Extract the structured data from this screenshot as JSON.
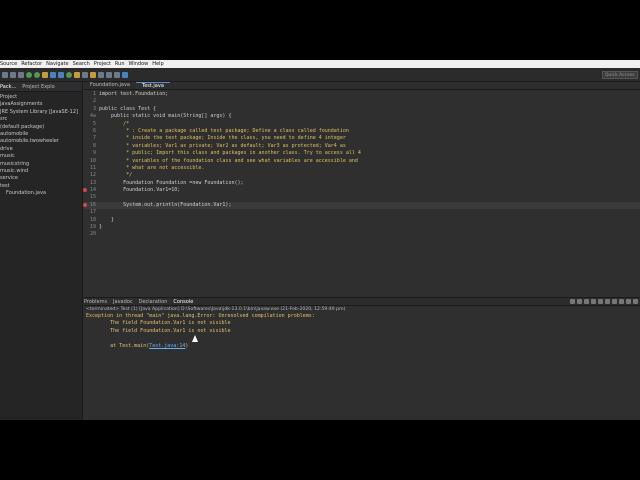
{
  "menu": [
    "Source",
    "Refactor",
    "Navigate",
    "Search",
    "Project",
    "Run",
    "Window",
    "Help"
  ],
  "quick_access_label": "Quick Access",
  "left_panel": {
    "tabs": [
      "Pack...",
      "Project Explo"
    ],
    "tree": [
      "Project",
      "javaAssignments",
      "JRE System Library [JavaSE-12]",
      "src",
      "(default package)",
      "automobile",
      "automobile.twowheeler",
      "drive",
      "music",
      "musicstring",
      "music.wind",
      "service",
      "test",
      "Foundation.java"
    ]
  },
  "editor": {
    "tabs": [
      "Foundation.java",
      "Test.java"
    ],
    "lines": [
      {
        "n": "1",
        "t": "import test.Foundation;"
      },
      {
        "n": "2",
        "t": ""
      },
      {
        "n": "3",
        "t": "public class Test {"
      },
      {
        "n": "4⊖",
        "t": "    public static void main(String[] args) {"
      },
      {
        "n": "5",
        "t": "        /*"
      },
      {
        "n": "6",
        "t": "         * : Create a package called test package; Define a class called foundation"
      },
      {
        "n": "7",
        "t": "         * inside the test package; Inside the class, you need to define 4 integer"
      },
      {
        "n": "8",
        "t": "         * variables; Var1 as private; Var2 as default; Var3 as protected; Var4 as"
      },
      {
        "n": "9",
        "t": "         * public; Import this class and packages in another class. Try to access all 4"
      },
      {
        "n": "10",
        "t": "         * variables of the foundation class and see what variables are accessible and"
      },
      {
        "n": "11",
        "t": "         * what are not accessible."
      },
      {
        "n": "12",
        "t": "         */"
      },
      {
        "n": "13",
        "t": "        Foundation Foundation =new Foundation();"
      },
      {
        "n": "14",
        "t": "        Foundation.Var1=10;"
      },
      {
        "n": "15",
        "t": ""
      },
      {
        "n": "16",
        "t": "        System.out.println(Foundation.Var1);"
      },
      {
        "n": "17",
        "t": ""
      },
      {
        "n": "18",
        "t": "    }"
      },
      {
        "n": "19",
        "t": "}"
      },
      {
        "n": "20",
        "t": ""
      }
    ]
  },
  "console": {
    "tabs": [
      "Problems",
      "Javadoc",
      "Declaration",
      "Console"
    ],
    "status": "<terminated> Test (1) [Java Application] D:\\Softwares\\Java\\jdk-13.0.1\\bin\\javaw.exe (21-Feb-2020, 12:59:49 pm)",
    "line1": "Exception in thread \"main\" java.lang.Error: Unresolved compilation problems:",
    "line2": "        The field Foundation.Var1 is not visible",
    "line3": "        The field Foundation.Var1 is not visible",
    "line4_prefix": "        at Test.main(",
    "line4_link": "Test.java:14",
    "line4_suffix": ")"
  }
}
